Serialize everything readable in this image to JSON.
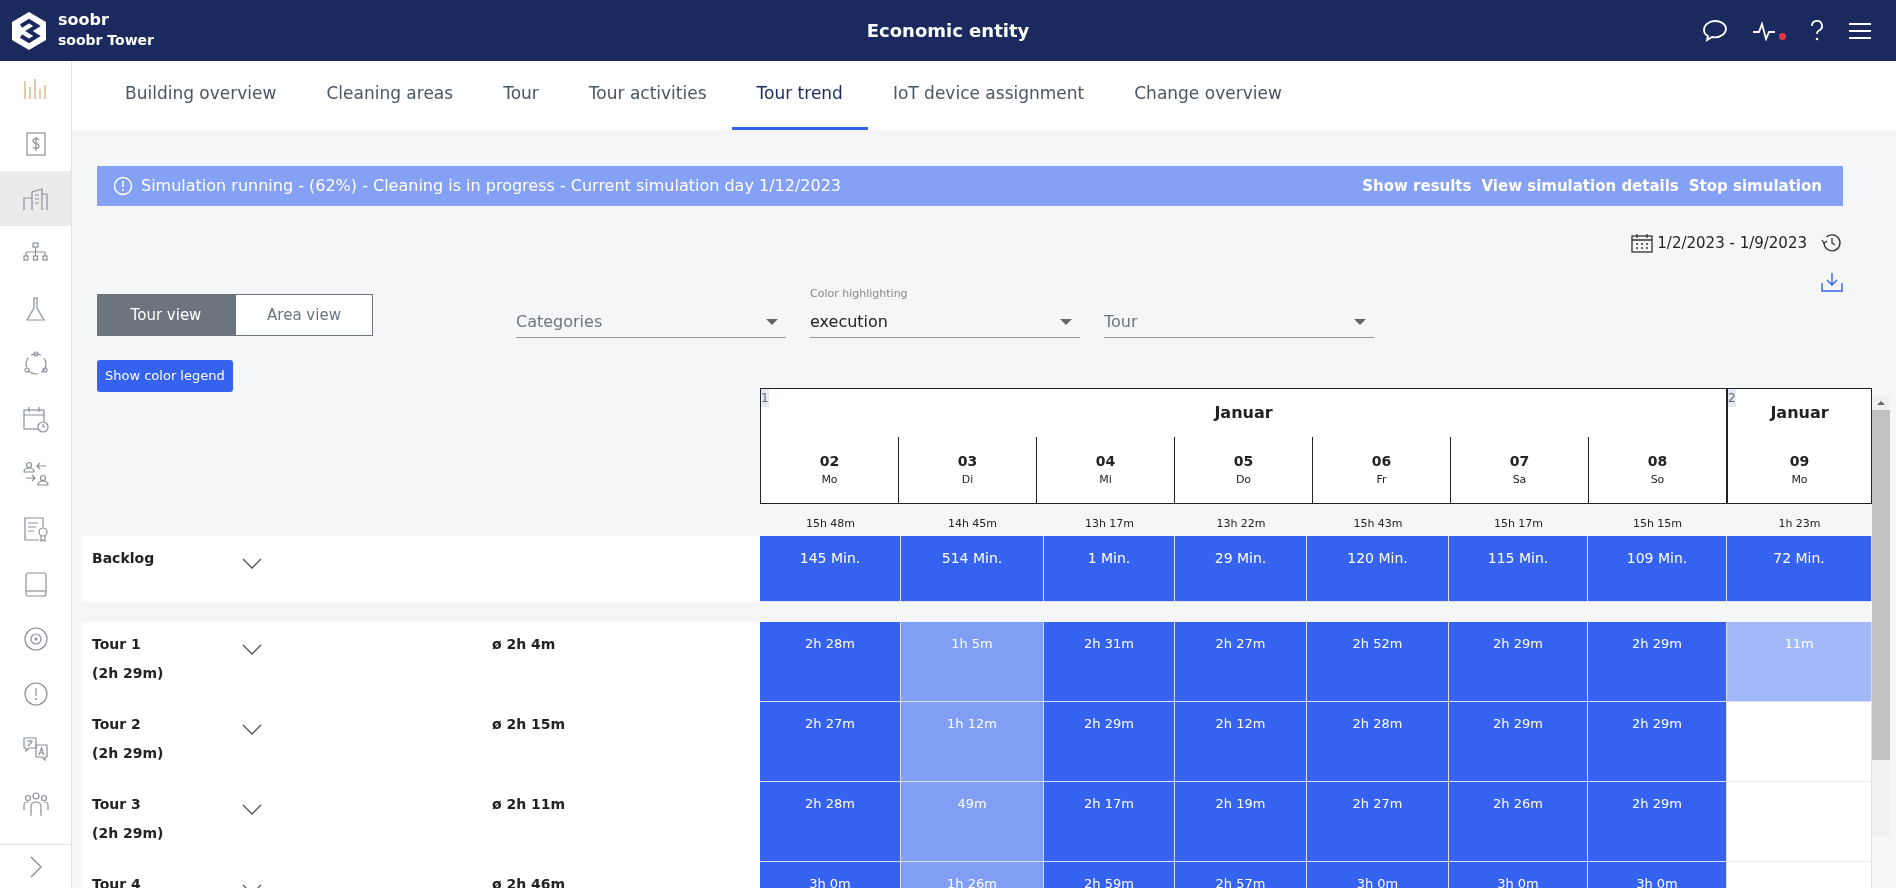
{
  "header": {
    "brand": "soobr",
    "subtitle": "soobr Tower",
    "title": "Economic entity",
    "notification": true
  },
  "sidebar": {
    "items": [
      {
        "kind": "chart",
        "selected": false
      },
      {
        "kind": "dollar",
        "selected": false
      },
      {
        "kind": "buildings",
        "selected": true
      },
      {
        "kind": "hierarchy",
        "selected": false
      },
      {
        "kind": "flask",
        "selected": false
      },
      {
        "kind": "cycle",
        "selected": false
      },
      {
        "kind": "calendar",
        "selected": false
      },
      {
        "kind": "exchange",
        "selected": false
      },
      {
        "kind": "certificate",
        "selected": false
      },
      {
        "kind": "tablet",
        "selected": false
      },
      {
        "kind": "target",
        "selected": false
      },
      {
        "kind": "alert",
        "selected": false
      },
      {
        "kind": "translate",
        "selected": false
      },
      {
        "kind": "team",
        "selected": false
      }
    ]
  },
  "tabs": [
    {
      "label": "Building overview",
      "selected": false
    },
    {
      "label": "Cleaning areas",
      "selected": false
    },
    {
      "label": "Tour",
      "selected": false
    },
    {
      "label": "Tour activities",
      "selected": false
    },
    {
      "label": "Tour trend",
      "selected": true
    },
    {
      "label": "IoT device assignment",
      "selected": false
    },
    {
      "label": "Change overview",
      "selected": false
    }
  ],
  "banner": {
    "text": "Simulation running - (62%) - Cleaning is in progress - Current simulation day 1/12/2023",
    "actions": [
      "Show results",
      "View simulation details",
      "Stop simulation"
    ]
  },
  "date_range": "1/2/2023 - 1/9/2023",
  "view_toggle": [
    {
      "label": "Tour view",
      "selected": true
    },
    {
      "label": "Area view",
      "selected": false
    }
  ],
  "legend_button": "Show color legend",
  "filters": [
    {
      "placeholder": "Categories"
    },
    {
      "label": "Color highlighting",
      "value": "execution"
    },
    {
      "placeholder": "Tour"
    }
  ],
  "calendar": {
    "months": [
      {
        "week": "1",
        "name": "Januar",
        "days": [
          {
            "day": "02",
            "weekday": "Mo"
          },
          {
            "day": "03",
            "weekday": "Di"
          },
          {
            "day": "04",
            "weekday": "Mi"
          },
          {
            "day": "05",
            "weekday": "Do"
          },
          {
            "day": "06",
            "weekday": "Fr"
          },
          {
            "day": "07",
            "weekday": "Sa"
          },
          {
            "day": "08",
            "weekday": "So"
          }
        ]
      },
      {
        "week": "2",
        "name": "Januar",
        "days": [
          {
            "day": "09",
            "weekday": "Mo"
          }
        ]
      }
    ]
  },
  "totals": [
    "15h 48m",
    "14h 45m",
    "13h 17m",
    "13h 22m",
    "15h 43m",
    "15h 17m",
    "15h 15m",
    "1h 23m"
  ],
  "backlog": {
    "label": "Backlog",
    "cells": [
      "145 Min.",
      "514 Min.",
      "1 Min.",
      "29 Min.",
      "120 Min.",
      "115 Min.",
      "109 Min.",
      "72 Min."
    ]
  },
  "tours": [
    {
      "name": "Tour 1",
      "total": "(2h 29m)",
      "average": "ø 2h 4m",
      "cells": [
        {
          "text": "2h 28m",
          "color": "#3563f0"
        },
        {
          "text": "1h 5m",
          "color": "#7f9ef4"
        },
        {
          "text": "2h 31m",
          "color": "#3563f0"
        },
        {
          "text": "2h 27m",
          "color": "#3563f0"
        },
        {
          "text": "2h 52m",
          "color": "#3563f0"
        },
        {
          "text": "2h 29m",
          "color": "#3563f0"
        },
        {
          "text": "2h 29m",
          "color": "#3563f0"
        },
        {
          "text": "11m",
          "color": "#a3b9f7"
        }
      ]
    },
    {
      "name": "Tour 2",
      "total": "(2h 29m)",
      "average": "ø 2h 15m",
      "cells": [
        {
          "text": "2h 27m",
          "color": "#3563f0"
        },
        {
          "text": "1h 12m",
          "color": "#7f9ef4"
        },
        {
          "text": "2h 29m",
          "color": "#3563f0"
        },
        {
          "text": "2h 12m",
          "color": "#3563f0"
        },
        {
          "text": "2h 28m",
          "color": "#3563f0"
        },
        {
          "text": "2h 29m",
          "color": "#3563f0"
        },
        {
          "text": "2h 29m",
          "color": "#3563f0"
        }
      ]
    },
    {
      "name": "Tour 3",
      "total": "(2h 29m)",
      "average": "ø 2h 11m",
      "cells": [
        {
          "text": "2h 28m",
          "color": "#3563f0"
        },
        {
          "text": "49m",
          "color": "#7f9ef4"
        },
        {
          "text": "2h 17m",
          "color": "#3563f0"
        },
        {
          "text": "2h 19m",
          "color": "#3563f0"
        },
        {
          "text": "2h 27m",
          "color": "#3563f0"
        },
        {
          "text": "2h 26m",
          "color": "#3563f0"
        },
        {
          "text": "2h 29m",
          "color": "#3563f0"
        }
      ]
    },
    {
      "name": "Tour 4",
      "average": "ø 2h 46m",
      "cells": [
        {
          "text": "3h 0m",
          "color": "#3563f0"
        },
        {
          "text": "1h 26m",
          "color": "#7f9ef4"
        },
        {
          "text": "2h 59m",
          "color": "#3563f0"
        },
        {
          "text": "2h 57m",
          "color": "#3563f0"
        },
        {
          "text": "3h 0m",
          "color": "#3563f0"
        },
        {
          "text": "3h 0m",
          "color": "#3563f0"
        },
        {
          "text": "3h 0m",
          "color": "#3563f0"
        }
      ]
    }
  ]
}
